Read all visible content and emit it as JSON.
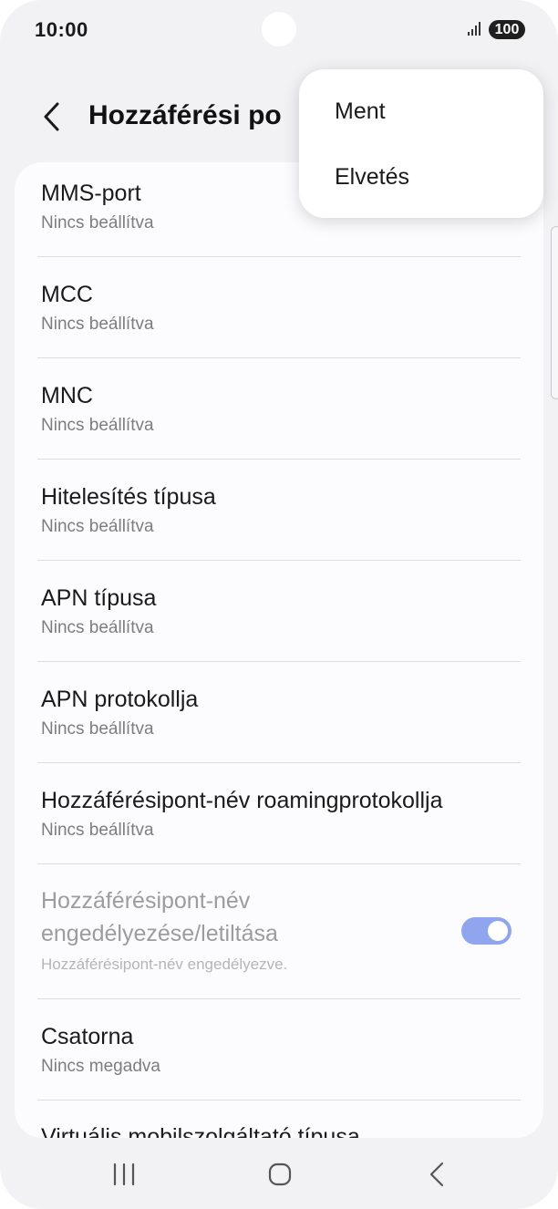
{
  "status_bar": {
    "time": "10:00",
    "battery": "100",
    "signal_icon": "signal-bars-icon"
  },
  "header": {
    "title": "Hozzáférési po",
    "back_icon": "chevron-left-icon"
  },
  "popup_menu": {
    "items": [
      "Ment",
      "Elvetés"
    ]
  },
  "settings": {
    "items": [
      {
        "title": "MMS-port",
        "subtitle": "Nincs beállítva"
      },
      {
        "title": "MCC",
        "subtitle": "Nincs beállítva"
      },
      {
        "title": "MNC",
        "subtitle": "Nincs beállítva"
      },
      {
        "title": "Hitelesítés típusa",
        "subtitle": "Nincs beállítva"
      },
      {
        "title": "APN típusa",
        "subtitle": "Nincs beállítva"
      },
      {
        "title": "APN protokollja",
        "subtitle": "Nincs beállítva"
      },
      {
        "title": "Hozzáférésipont-név roamingprotokollja",
        "subtitle": "Nincs beállítva"
      },
      {
        "title_line1": "Hozzáférésipont-név",
        "title_line2": "engedélyezése/letiltása",
        "subtitle": "Hozzáférésipont-név engedélyezve.",
        "toggle_on": true,
        "disabled": true
      },
      {
        "title": "Csatorna",
        "subtitle": "Nincs megadva"
      },
      {
        "title": "Virtuális mobilszolgáltató típusa",
        "subtitle": ""
      }
    ]
  },
  "nav_bar": {
    "recents_icon": "recents-icon",
    "home_icon": "home-icon",
    "back_icon": "back-icon"
  },
  "colors": {
    "background": "#f2f2f4",
    "card": "#fcfcfe",
    "toggle_on": "#8fa6ee",
    "text_primary": "#1a1a1a",
    "text_secondary": "#7d7d7d"
  }
}
